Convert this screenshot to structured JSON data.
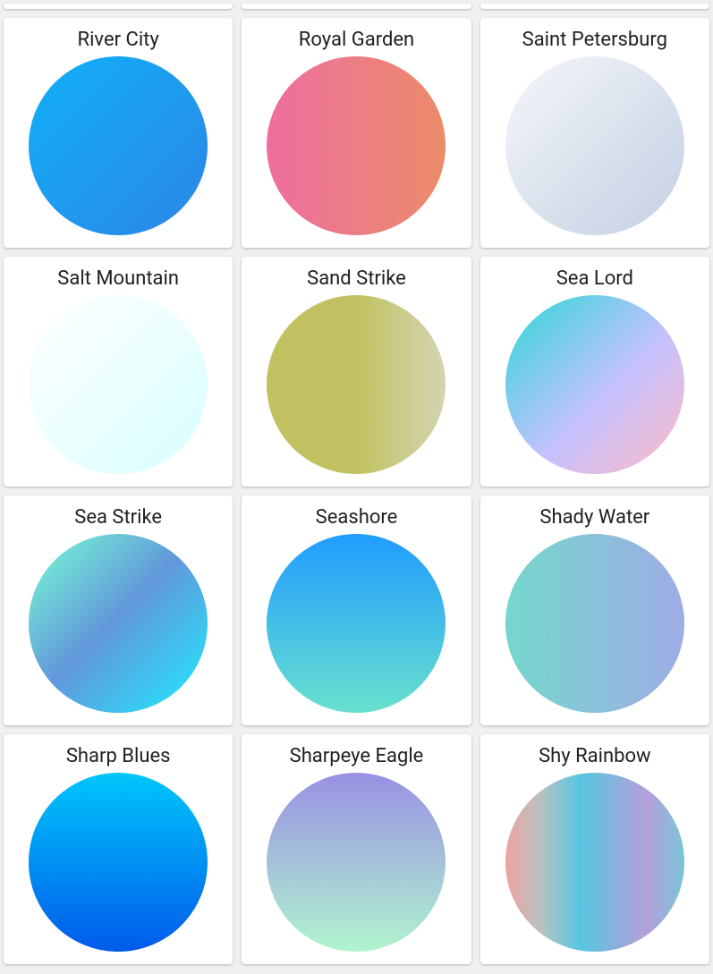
{
  "gradients": [
    {
      "name": "River City",
      "css": "linear-gradient(135deg, #11b0f7 0%, #2b86e6 100%)"
    },
    {
      "name": "Royal Garden",
      "css": "linear-gradient(90deg, #ed6ea0 0%, #ec8c69 100%)"
    },
    {
      "name": "Saint Petersburg",
      "css": "linear-gradient(135deg, #f5f7fa 0%, #c3cfe2 100%)"
    },
    {
      "name": "Salt Mountain",
      "css": "linear-gradient(135deg, #ffffff 0%, #d7fffe 100%)"
    },
    {
      "name": "Sand Strike",
      "css": "linear-gradient(90deg, #c1c161 0%, #c1c161 50%, #d4d4b1 100%)"
    },
    {
      "name": "Sea Lord",
      "css": "linear-gradient(135deg, #2cd8d5 0%, #c5c1ff 56%, #ffbac3 100%)"
    },
    {
      "name": "Sea Strike",
      "css": "linear-gradient(135deg, #77ffd2 0%, #6297db 48%, #1eecff 100%)"
    },
    {
      "name": "Seashore",
      "css": "linear-gradient(180deg, #209cff 0%, #68e0cf 100%)"
    },
    {
      "name": "Shady Water",
      "css": "linear-gradient(90deg, #74d7cc 0%, #9face6 100%)"
    },
    {
      "name": "Sharp Blues",
      "css": "linear-gradient(180deg, #00c6fb 0%, #005bea 100%)"
    },
    {
      "name": "Sharpeye Eagle",
      "css": "linear-gradient(180deg, #9890e3 0%, #b1f4cf 100%)"
    },
    {
      "name": "Shy Rainbow",
      "css": "linear-gradient(90deg, #eea2a2 0%, #bbc1bf 19%, #57c6e1 42%, #b49fda 79%, #7ac5d8 100%)"
    }
  ]
}
